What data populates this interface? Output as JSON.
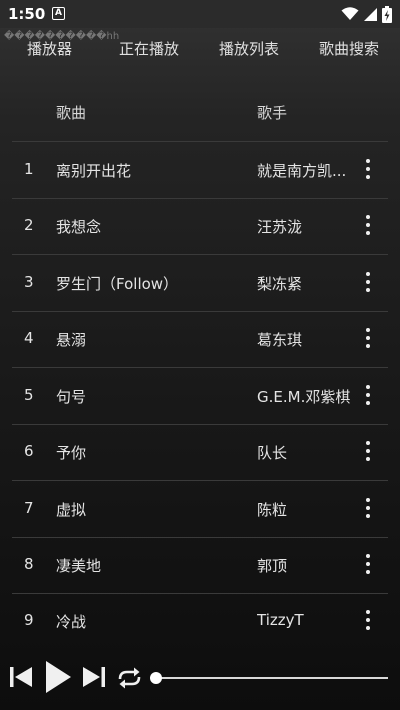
{
  "status_bar": {
    "time": "1:50",
    "notification_icon": "A"
  },
  "header": {
    "garbled_text": "����������hh",
    "tabs": [
      {
        "label": "播放器"
      },
      {
        "label": "正在播放"
      },
      {
        "label": "播放列表"
      },
      {
        "label": "歌曲搜索"
      }
    ]
  },
  "list": {
    "col_song": "歌曲",
    "col_artist": "歌手",
    "rows": [
      {
        "num": "1",
        "title": "离别开出花",
        "artist": "就是南方凯..."
      },
      {
        "num": "2",
        "title": "我想念",
        "artist": "汪苏泷"
      },
      {
        "num": "3",
        "title": "罗生门（Follow）",
        "artist": "梨冻紧"
      },
      {
        "num": "4",
        "title": "悬溺",
        "artist": "葛东琪"
      },
      {
        "num": "5",
        "title": "句号",
        "artist": "G.E.M.邓紫棋"
      },
      {
        "num": "6",
        "title": "予你",
        "artist": "队长"
      },
      {
        "num": "7",
        "title": "虚拟",
        "artist": "陈粒"
      },
      {
        "num": "8",
        "title": "凄美地",
        "artist": "郭顶"
      },
      {
        "num": "9",
        "title": "冷战",
        "artist": "TizzyT"
      }
    ]
  },
  "player": {
    "controls": [
      "previous-icon",
      "play-icon",
      "next-icon",
      "repeat-icon"
    ],
    "progress_fraction": 0
  },
  "colors": {
    "background_top": "#3a3a3a",
    "background_bottom": "#0d0d0d",
    "text": "#e4e4e4",
    "divider": "#3a3a3a"
  }
}
